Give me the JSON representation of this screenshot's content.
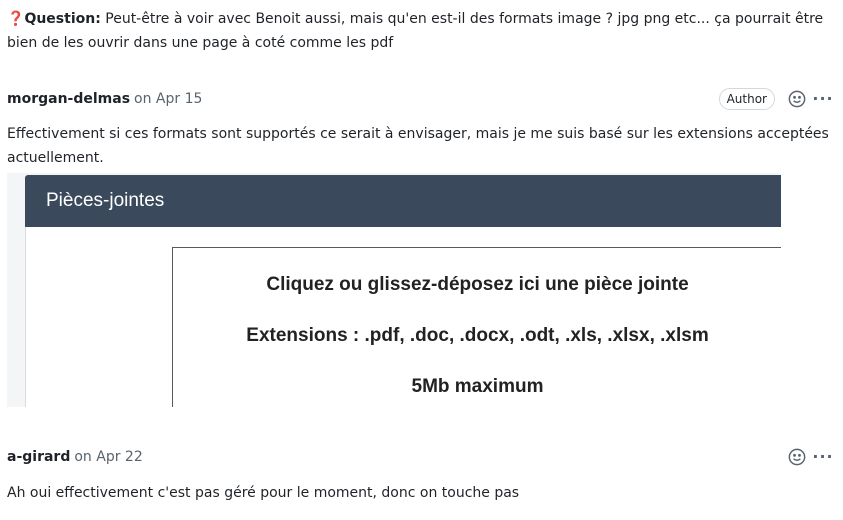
{
  "comment1": {
    "icon": "❓",
    "label": "Question:",
    "text": " Peut-être à voir avec Benoit aussi, mais qu'en est-il des formats image ? jpg png etc... ça pourrait être bien de les ouvrir dans une page à coté comme les pdf"
  },
  "comment2": {
    "author": "morgan-delmas",
    "date": "on Apr 15",
    "badge": "Author",
    "body": "Effectivement si ces formats sont supportés ce serait à envisager, mais je me suis basé sur les extensions acceptées actuellement.",
    "screenshot": {
      "header": "Pièces-jointes",
      "line1": "Cliquez ou glissez-déposez ici une pièce jointe",
      "line2": "Extensions : .pdf, .doc, .docx, .odt, .xls, .xlsx, .xlsm",
      "line3": "5Mb maximum"
    }
  },
  "comment3": {
    "author": "a-girard",
    "date": "on Apr 22",
    "body": "Ah oui effectivement c'est pas géré pour le moment, donc on touche pas"
  },
  "icons": {
    "emoji": "smiley-icon",
    "more": "kebab-icon"
  }
}
